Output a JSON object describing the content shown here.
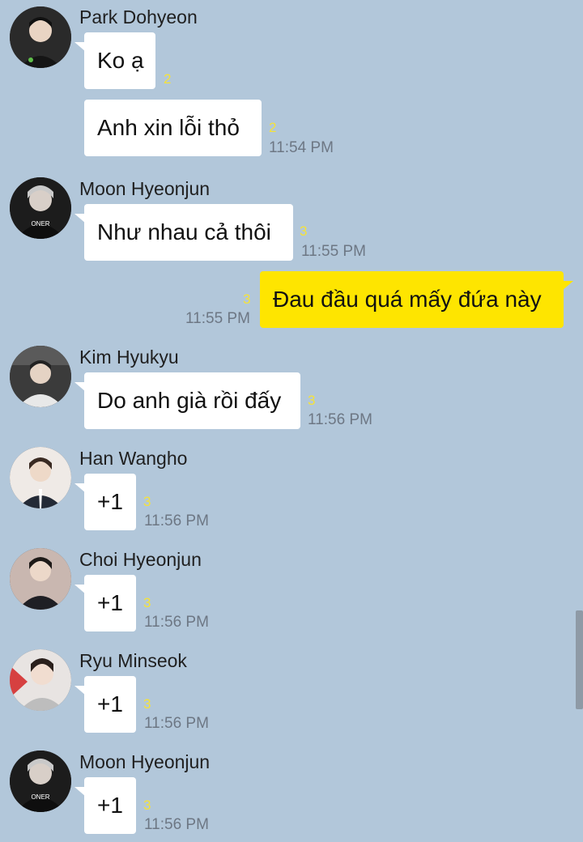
{
  "messages": [
    {
      "sender": "Park Dohyeon",
      "avatar_icon": "profile-photo-icon",
      "text": "Ko ạ",
      "unread": "2",
      "time": ""
    },
    {
      "sender": "",
      "avatar_icon": "",
      "text": "Anh xin lỗi thỏ",
      "unread": "2",
      "time": "11:54 PM"
    },
    {
      "sender": "Moon Hyeonjun",
      "avatar_icon": "profile-photo-icon",
      "text": "Như nhau cả thôi",
      "unread": "3",
      "time": "11:55 PM"
    },
    {
      "sender": "me",
      "avatar_icon": "",
      "text": "Đau đầu quá mấy đứa này",
      "unread": "3",
      "time": "11:55 PM"
    },
    {
      "sender": "Kim Hyukyu",
      "avatar_icon": "profile-photo-icon",
      "text": "Do anh già rồi đấy",
      "unread": "3",
      "time": "11:56 PM"
    },
    {
      "sender": "Han Wangho",
      "avatar_icon": "profile-photo-icon",
      "text": "+1",
      "unread": "3",
      "time": "11:56 PM"
    },
    {
      "sender": "Choi Hyeonjun",
      "avatar_icon": "profile-photo-icon",
      "text": "+1",
      "unread": "3",
      "time": "11:56 PM"
    },
    {
      "sender": "Ryu Minseok",
      "avatar_icon": "profile-photo-icon",
      "text": "+1",
      "unread": "3",
      "time": "11:56 PM"
    },
    {
      "sender": "Moon Hyeonjun",
      "avatar_icon": "profile-photo-icon",
      "text": "+1",
      "unread": "3",
      "time": "11:56 PM"
    }
  ],
  "avatar_text": {
    "oner": "ONER"
  },
  "colors": {
    "background": "#b2c7da",
    "incoming_bubble": "#ffffff",
    "outgoing_bubble": "#fee500",
    "unread_count": "#f5e23a",
    "timestamp": "#6d7784"
  }
}
